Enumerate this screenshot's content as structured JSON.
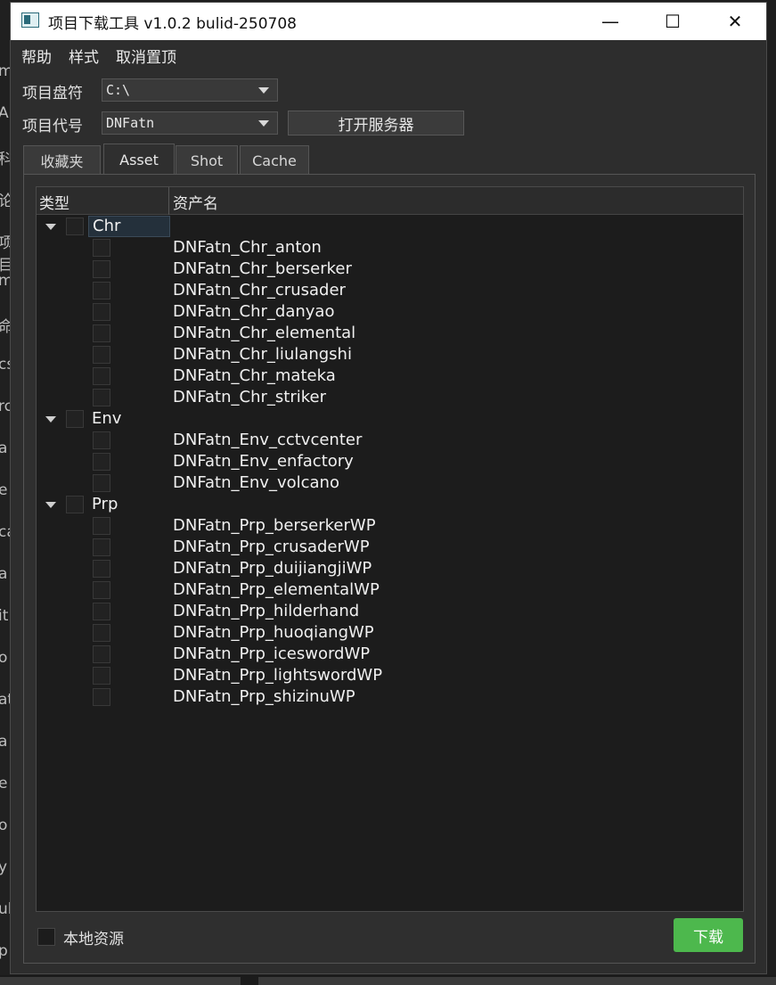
{
  "window": {
    "title": "项目下载工具 v1.0.2 bulid-250708",
    "controls": {
      "minimize": "—",
      "maximize": "☐",
      "close": "✕"
    }
  },
  "menu": [
    "帮助",
    "样式",
    "取消置顶"
  ],
  "form": {
    "drive_label": "项目盘符",
    "drive_value": "C:\\",
    "project_label": "项目代号",
    "project_value": "DNFatn",
    "open_server_label": "打开服务器"
  },
  "tabs": [
    {
      "label": "收藏夹",
      "active": false
    },
    {
      "label": "Asset",
      "active": true
    },
    {
      "label": "Shot",
      "active": false
    },
    {
      "label": "Cache",
      "active": false
    }
  ],
  "tree": {
    "columns": [
      "类型",
      "资产名"
    ],
    "groups": [
      {
        "label": "Chr",
        "selected": true,
        "items": [
          "DNFatn_Chr_anton",
          "DNFatn_Chr_berserker",
          "DNFatn_Chr_crusader",
          "DNFatn_Chr_danyao",
          "DNFatn_Chr_elemental",
          "DNFatn_Chr_liulangshi",
          "DNFatn_Chr_mateka",
          "DNFatn_Chr_striker"
        ]
      },
      {
        "label": "Env",
        "selected": false,
        "items": [
          "DNFatn_Env_cctvcenter",
          "DNFatn_Env_enfactory",
          "DNFatn_Env_volcano"
        ]
      },
      {
        "label": "Prp",
        "selected": false,
        "items": [
          "DNFatn_Prp_berserkerWP",
          "DNFatn_Prp_crusaderWP",
          "DNFatn_Prp_duijiangjiWP",
          "DNFatn_Prp_elementalWP",
          "DNFatn_Prp_hilderhand",
          "DNFatn_Prp_huoqiangWP",
          "DNFatn_Prp_iceswordWP",
          "DNFatn_Prp_lightswordWP",
          "DNFatn_Prp_shizinuWP"
        ]
      }
    ]
  },
  "footer": {
    "local_resource_label": "本地资源",
    "download_label": "下载"
  },
  "background_fragments": [
    "m",
    "A(",
    "科",
    "论",
    "项目",
    "m",
    "命",
    "cs",
    "rc",
    "a",
    "e",
    "ca",
    "a",
    "it",
    "o",
    "at",
    "a",
    "e",
    "o",
    "y",
    "ul",
    "p"
  ],
  "colors": {
    "accent": "#4db84d",
    "panel": "#2d2d2d",
    "tree_bg": "#1c1c1c"
  }
}
